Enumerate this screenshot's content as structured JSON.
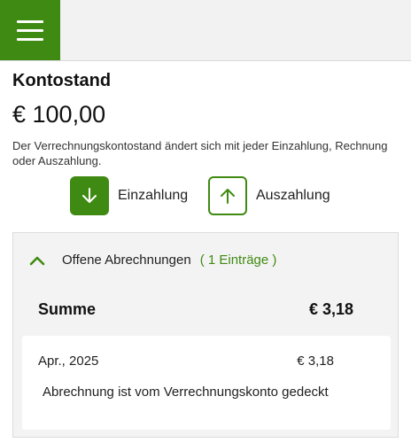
{
  "header": {
    "menu_icon": "hamburger-menu-icon"
  },
  "account": {
    "title": "Kontostand",
    "balance": "€ 100,00",
    "description": "Der Verrechnungskontostand ändert sich mit jeder Einzahlung, Rechnung oder Auszahlung."
  },
  "actions": {
    "deposit_label": "Einzahlung",
    "deposit_icon": "arrow-down-icon",
    "withdraw_label": "Auszahlung",
    "withdraw_icon": "arrow-up-icon"
  },
  "open_settlements": {
    "title": "Offene Abrechnungen",
    "count": "( 1 Einträge )",
    "expanded_icon": "chevron-up-icon",
    "sum_label": "Summe",
    "sum_value": "€ 3,18",
    "entries": [
      {
        "date": "Apr., 2025",
        "amount": "€ 3,18",
        "note": "Abrechnung ist vom Verrechnungskonto gedeckt"
      }
    ]
  },
  "colors": {
    "accent": "#3f8a12",
    "panel_bg": "#f3f3f3",
    "topbar_bg": "#f2f2f2"
  }
}
